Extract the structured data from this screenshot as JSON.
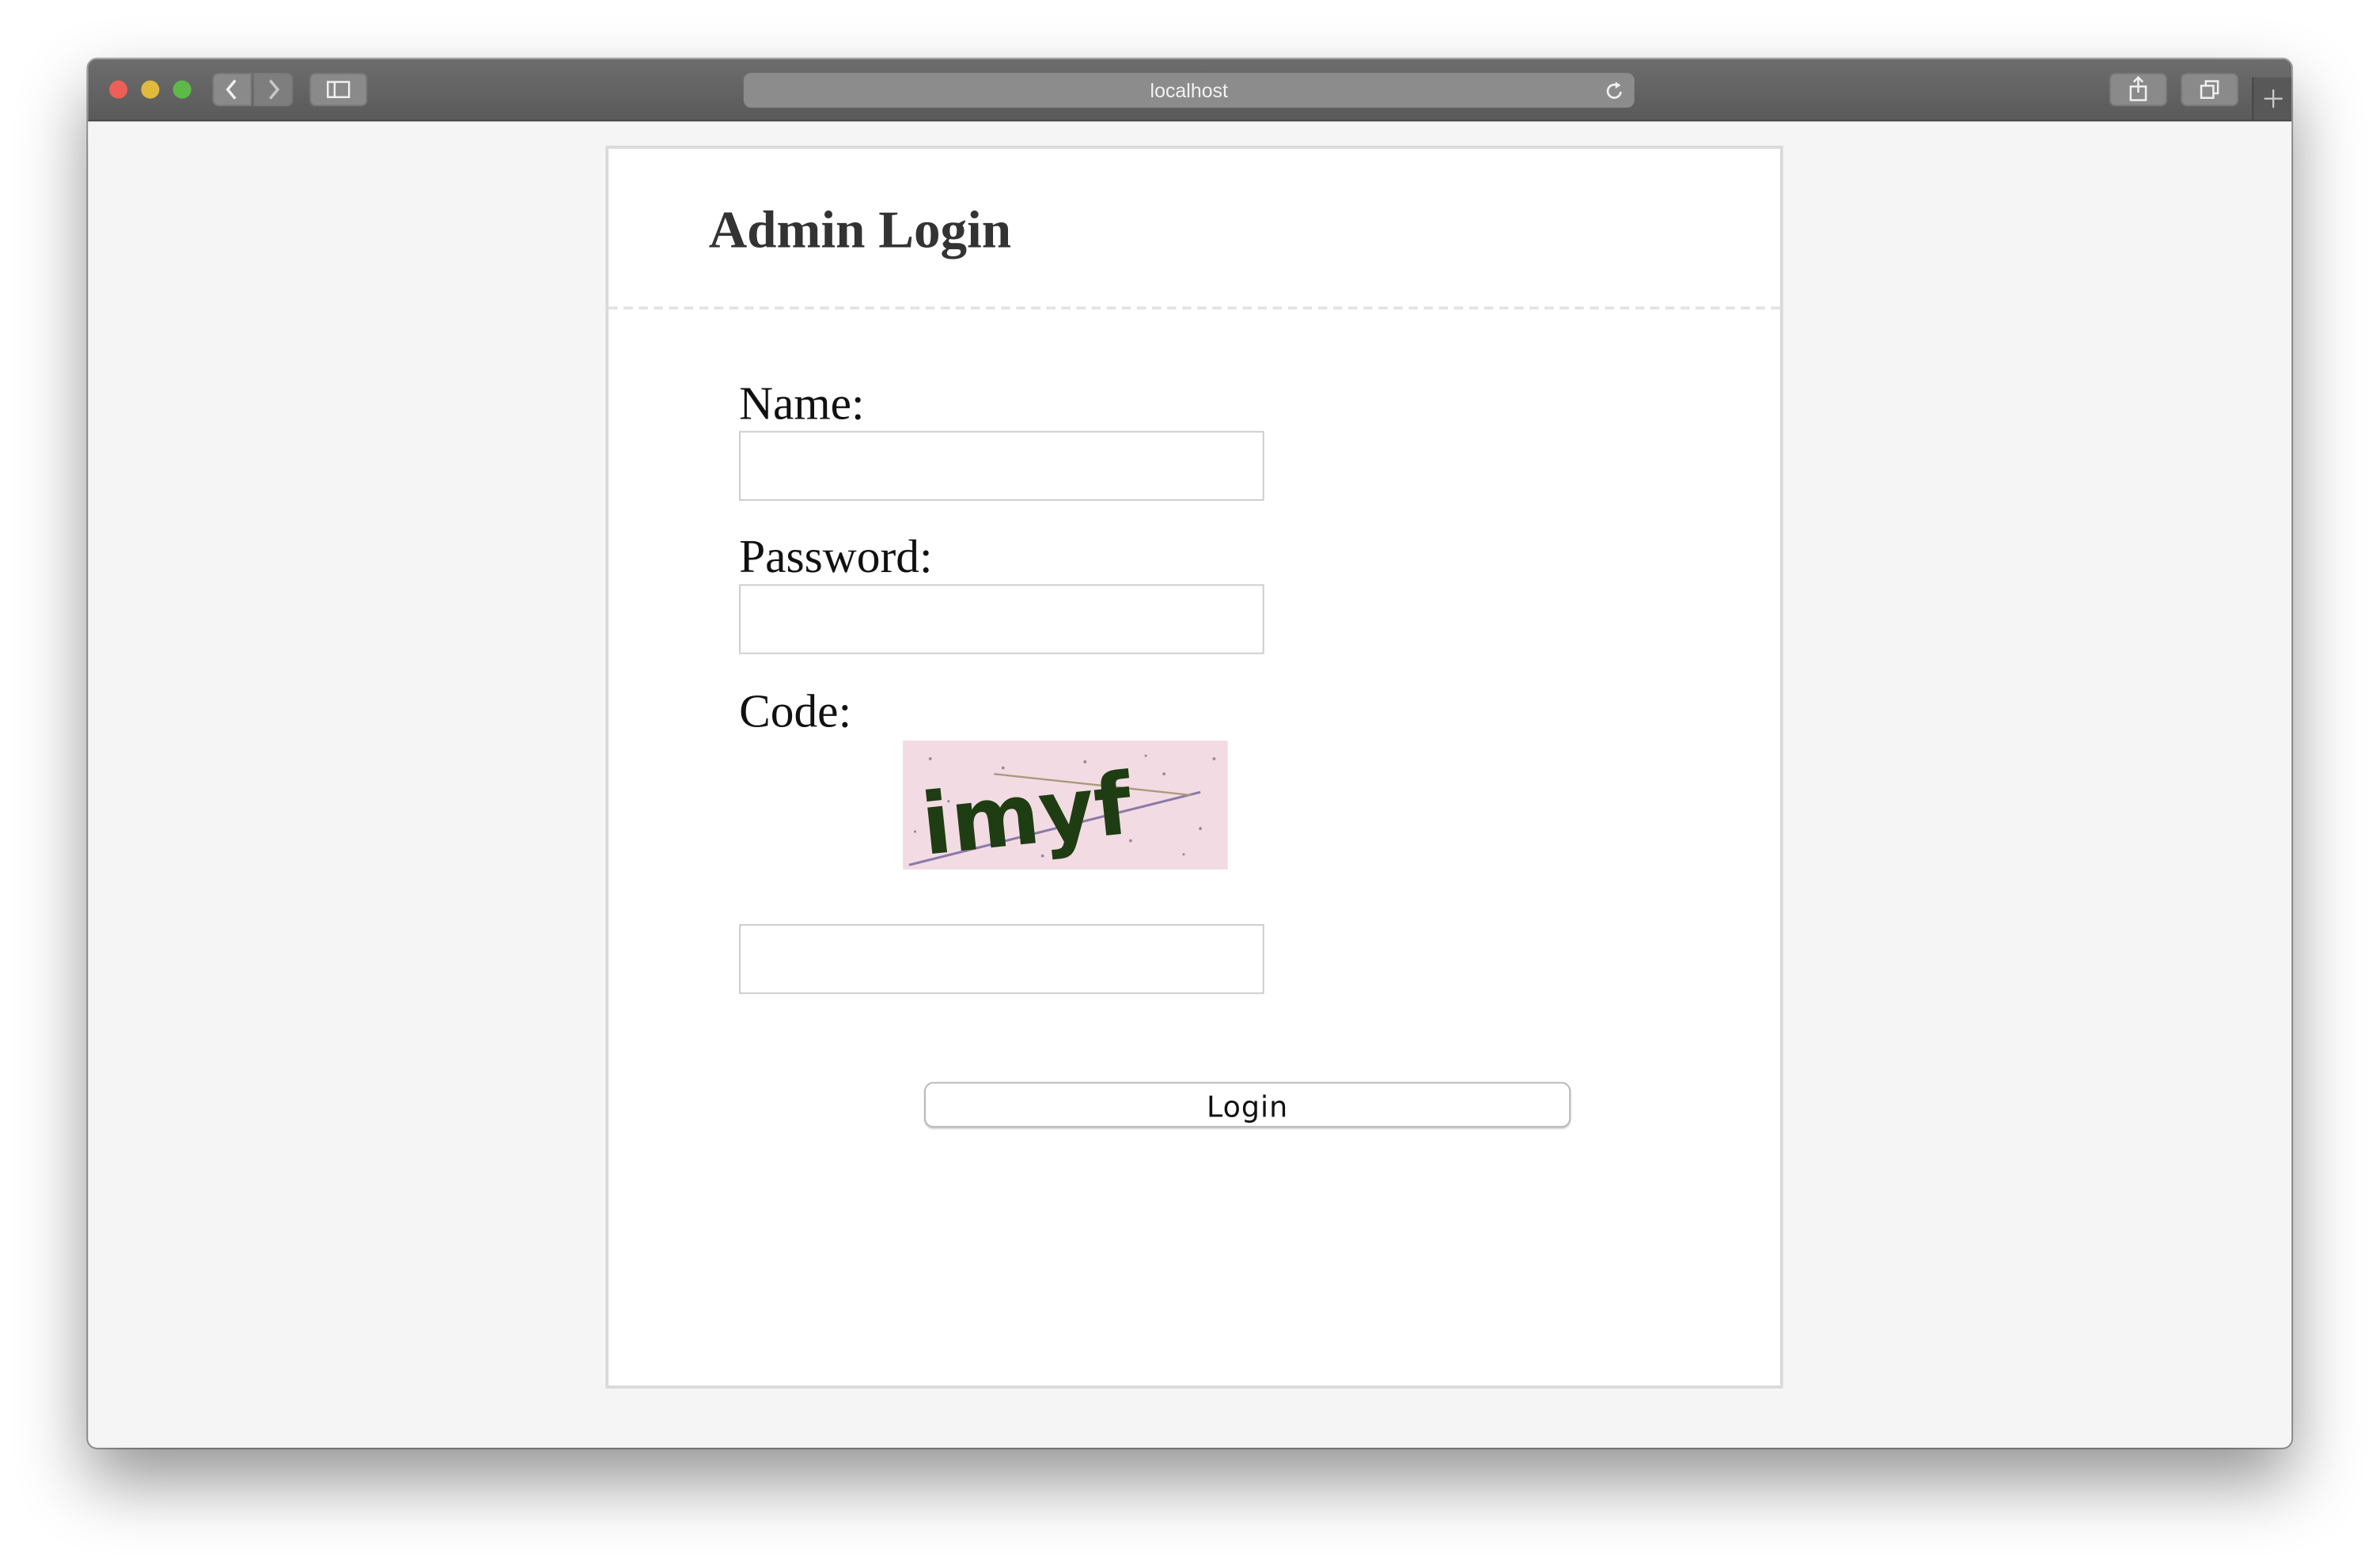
{
  "browser": {
    "address": "localhost",
    "icons": {
      "back": "chevron-left-icon",
      "forward": "chevron-right-icon",
      "sidebar": "sidebar-icon",
      "reload": "reload-icon",
      "share": "share-icon",
      "tabs": "tabs-overview-icon",
      "new_tab": "plus-icon"
    },
    "traffic_colors": [
      "#ed5f57",
      "#e0b93d",
      "#5fb94a"
    ]
  },
  "form": {
    "title": "Admin Login",
    "name_label": "Name:",
    "name_value": "",
    "password_label": "Password:",
    "password_value": "",
    "code_label": "Code:",
    "captcha_text": "imyf",
    "code_value": "",
    "submit_label": "Login"
  },
  "colors": {
    "page_background": "#f5f5f5",
    "card_border": "#d9d9d9",
    "title_text": "#333333",
    "captcha_background": "#f3dbe4",
    "captcha_text": "#1f3d12"
  }
}
